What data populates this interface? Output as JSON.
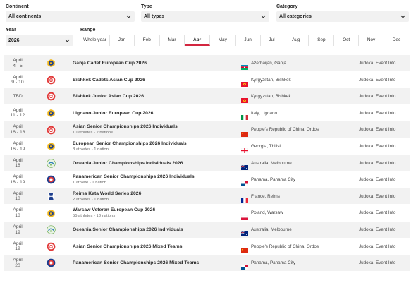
{
  "filters": {
    "continent": {
      "label": "Continent",
      "value": "All continents"
    },
    "type": {
      "label": "Type",
      "value": "All types"
    },
    "category": {
      "label": "Category",
      "value": "All categories"
    },
    "year": {
      "label": "Year",
      "value": "2026"
    },
    "range": {
      "label": "Range",
      "items": [
        "Whole year",
        "Jan",
        "Feb",
        "Mar",
        "Apr",
        "May",
        "Jun",
        "Jul",
        "Aug",
        "Sep",
        "Oct",
        "Nov",
        "Dec"
      ],
      "active": "Apr"
    }
  },
  "colors": {
    "accent": "#d3263f",
    "row_alt": "#f2f2f2"
  },
  "events": [
    {
      "month": "April",
      "days": "4 - 5",
      "name": "Ganja Cadet European Cup 2026",
      "sub": "",
      "logo": "ejudo-icon",
      "flag": "az",
      "location": "Azerbaijan, Ganja",
      "col1": "Judoka",
      "col2": "Event Info"
    },
    {
      "month": "April",
      "days": "9 - 10",
      "name": "Bishkek Cadets Asian Cup 2026",
      "sub": "",
      "logo": "asian-judo-icon",
      "flag": "kg",
      "location": "Kyrgyzstan, Bishkek",
      "col1": "Judoka",
      "col2": "Event Info"
    },
    {
      "month": "TBD",
      "days": "",
      "name": "Bishkek Junior Asian Cup 2026",
      "sub": "",
      "logo": "asian-judo-icon",
      "flag": "kg",
      "location": "Kyrgyzstan, Bishkek",
      "col1": "Judoka",
      "col2": "Event Info"
    },
    {
      "month": "April",
      "days": "11 - 12",
      "name": "Lignano Junior European Cup 2026",
      "sub": "",
      "logo": "ejudo-icon",
      "flag": "it",
      "location": "Italy, Lignano",
      "col1": "Judoka",
      "col2": "Event Info"
    },
    {
      "month": "April",
      "days": "16 - 18",
      "name": "Asian Senior Championships 2026 Individuals",
      "sub": "10 athletes - 2 nations",
      "logo": "asian-judo-icon",
      "flag": "cn",
      "location": "People's Republic of China, Ordos",
      "col1": "Judoka",
      "col2": "Event Info"
    },
    {
      "month": "April",
      "days": "16 - 19",
      "name": "European Senior Championships 2026 Individuals",
      "sub": "8 athletes - 1 nation",
      "logo": "ejudo-icon",
      "flag": "ge",
      "location": "Georgia, Tbilisi",
      "col1": "Judoka",
      "col2": "Event Info"
    },
    {
      "month": "April",
      "days": "18",
      "name": "Oceania Junior Championships Individuals 2026",
      "sub": "",
      "logo": "oceania-judo-icon",
      "flag": "au",
      "location": "Australia, Melbourne",
      "col1": "Judoka",
      "col2": "Event Info"
    },
    {
      "month": "April",
      "days": "18 - 19",
      "name": "Panamerican Senior Championships 2026 Individuals",
      "sub": "1 athlete - 1 nation",
      "logo": "panamerican-judo-icon",
      "flag": "pa",
      "location": "Panama, Panama City",
      "col1": "Judoka",
      "col2": "Event Info"
    },
    {
      "month": "April",
      "days": "18",
      "name": "Reims Kata World Series 2026",
      "sub": "2 athletes - 1 nation",
      "logo": "kata-icon",
      "flag": "fr",
      "location": "France, Reims",
      "col1": "Judoka",
      "col2": "Event Info"
    },
    {
      "month": "April",
      "days": "18",
      "name": "Warsaw Veteran European Cup 2026",
      "sub": "55 athletes - 13 nations",
      "logo": "ejudo-icon",
      "flag": "pl",
      "location": "Poland, Warsaw",
      "col1": "Judoka",
      "col2": "Event Info"
    },
    {
      "month": "April",
      "days": "19",
      "name": "Oceania Senior Championships 2026 Individuals",
      "sub": "",
      "logo": "oceania-judo-icon",
      "flag": "au",
      "location": "Australia, Melbourne",
      "col1": "Judoka",
      "col2": "Event Info"
    },
    {
      "month": "April",
      "days": "19",
      "name": "Asian Senior Championships 2026 Mixed Teams",
      "sub": "",
      "logo": "asian-judo-icon",
      "flag": "cn",
      "location": "People's Republic of China, Ordos",
      "col1": "Judoka",
      "col2": "Event Info"
    },
    {
      "month": "April",
      "days": "20",
      "name": "Panamerican Senior Championships 2026 Mixed Teams",
      "sub": "",
      "logo": "panamerican-judo-icon",
      "flag": "pa",
      "location": "Panama, Panama City",
      "col1": "Judoka",
      "col2": "Event Info"
    }
  ]
}
